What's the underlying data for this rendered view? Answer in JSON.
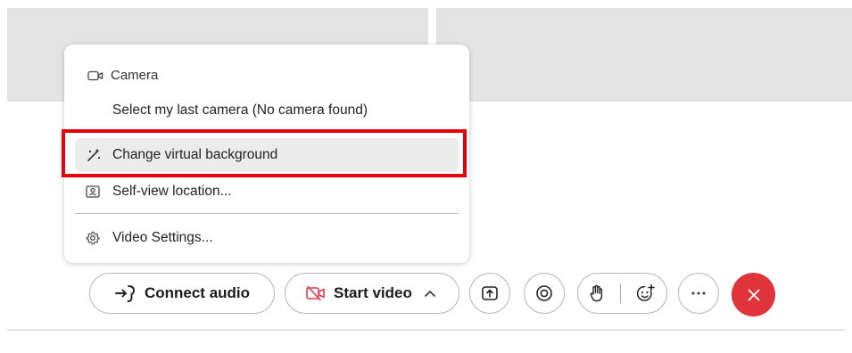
{
  "menu": {
    "header": {
      "label": "Camera",
      "icon": "camera-icon"
    },
    "items": [
      {
        "label": "Select my last camera (No camera found)",
        "icon": null
      },
      {
        "label": "Change virtual background",
        "icon": "magic-wand-icon",
        "highlighted": true
      },
      {
        "label": "Self-view location...",
        "icon": "self-view-icon"
      },
      {
        "label": "Video Settings...",
        "icon": "gear-icon"
      }
    ]
  },
  "controls": {
    "connect_audio": {
      "label": "Connect audio",
      "icon": "audio-connect-icon"
    },
    "start_video": {
      "label": "Start video",
      "icon": "video-off-icon",
      "chevron": "chevron-up-icon"
    },
    "share": {
      "icon": "share-screen-icon"
    },
    "record": {
      "icon": "record-icon"
    },
    "raise_hand": {
      "icon": "raise-hand-icon"
    },
    "reactions": {
      "icon": "reactions-icon"
    },
    "more": {
      "icon": "more-icon"
    },
    "end_call": {
      "icon": "close-icon"
    }
  },
  "colors": {
    "highlight_border": "#e8000b",
    "end_call_bg": "#e0343b",
    "video_off_icon": "#d93a56"
  }
}
